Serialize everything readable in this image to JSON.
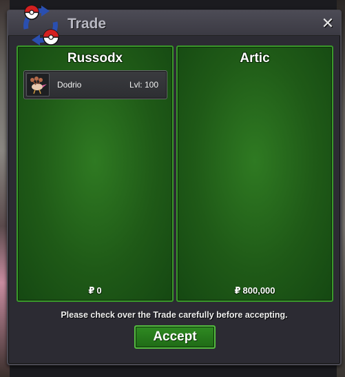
{
  "window": {
    "title": "Trade",
    "close_symbol": "✕"
  },
  "left_panel": {
    "player_name": "Russodx",
    "pokemon": [
      {
        "icon": "dodrio-sprite",
        "name": "Dodrio",
        "level_label": "Lvl: 100"
      }
    ],
    "currency_symbol": "₽",
    "money": "0"
  },
  "right_panel": {
    "player_name": "Artic",
    "pokemon": [],
    "currency_symbol": "₽",
    "money": "800,000"
  },
  "notice": "Please check over the Trade carefully before accepting.",
  "accept_label": "Accept",
  "colors": {
    "panel_green": "#1f5a17",
    "panel_border": "#3a9a2a",
    "window_bg": "#2c2b33",
    "title_text": "#b8b8c2"
  }
}
